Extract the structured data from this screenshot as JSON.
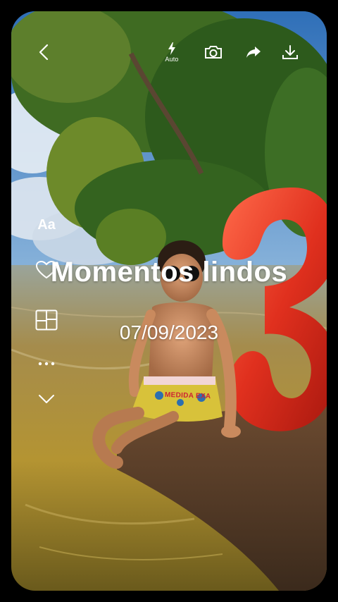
{
  "toolbar": {
    "flash_label": "Auto",
    "icons": [
      "back-arrow-icon",
      "flash-icon",
      "camera-icon",
      "share-icon",
      "download-icon"
    ]
  },
  "side_tools": {
    "text_label": "Aa",
    "icons": [
      "text-style-icon",
      "heart-sticker-icon",
      "layout-grid-icon",
      "more-icon",
      "chevron-down-icon"
    ]
  },
  "overlay": {
    "title": "Momentos lindos",
    "date": "07/09/2023"
  },
  "photo": {
    "shorts_print": "MEDIDA EXA"
  },
  "colors": {
    "background": "#000000",
    "sky": "#4b8fd6",
    "water": "#b8962f",
    "balloon": "#e0301e",
    "foliage": "#2f6a1e"
  }
}
